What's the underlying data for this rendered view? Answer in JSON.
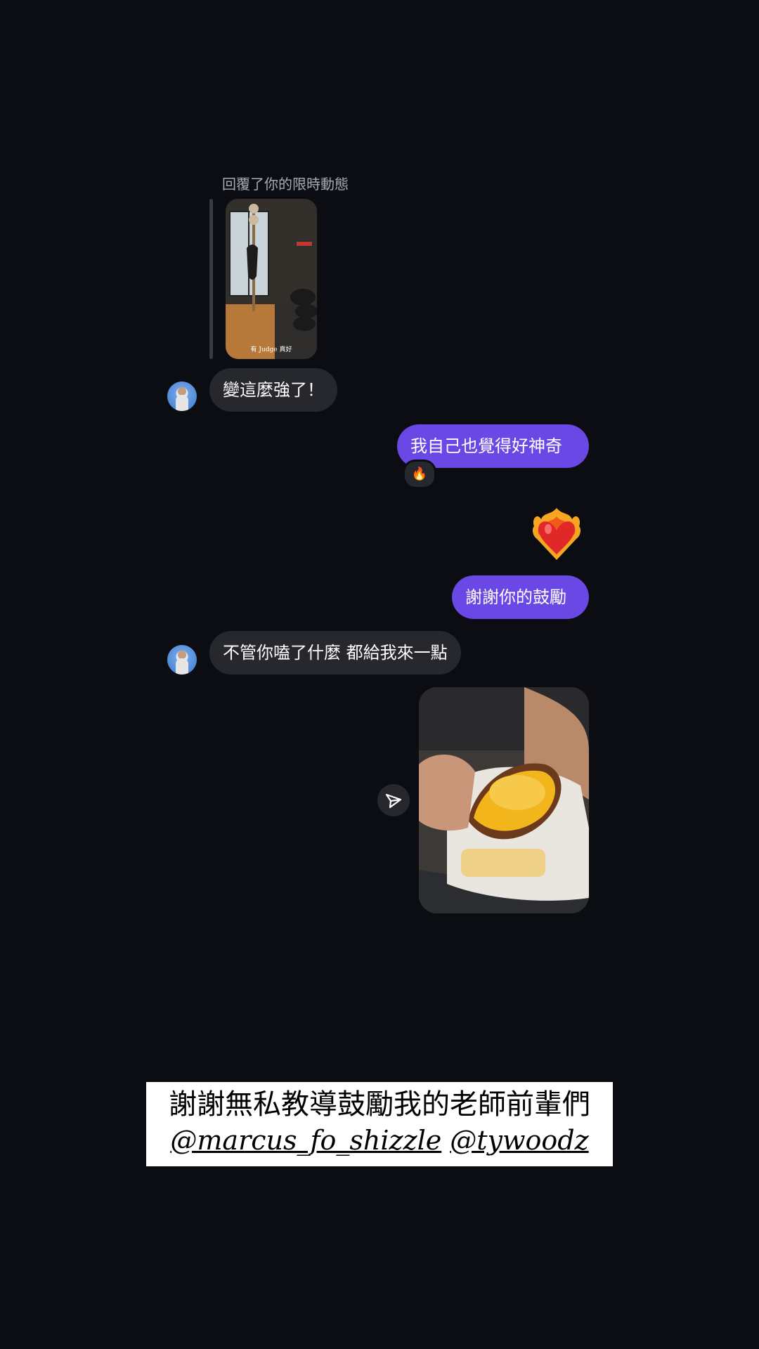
{
  "chat": {
    "reply_label": "回覆了你的限時動態",
    "story_thumbnail_caption": "有 Judge 真好",
    "messages": [
      {
        "direction": "incoming",
        "text": "變這麼強了！"
      },
      {
        "direction": "outgoing",
        "text": "我自己也覺得好神奇"
      },
      {
        "direction": "outgoing",
        "text": "謝謝你的鼓勵"
      },
      {
        "direction": "incoming",
        "text": "不管你嗑了什麼 都給我來一點"
      }
    ],
    "reaction_emoji": "🔥",
    "heart_emoji_name": "heart-on-fire-emoji"
  },
  "caption": {
    "line1": "謝謝無私教導鼓勵我的老師前輩們",
    "mentions": [
      "@marcus_fo_shizzle",
      "@tywoodz"
    ]
  },
  "colors": {
    "background": "#0b0d12",
    "incoming_bubble": "#26282e",
    "outgoing_bubble": "#6a48e5",
    "caption_bg": "#ffffff"
  },
  "icons": {
    "share": "paper-plane-icon"
  }
}
